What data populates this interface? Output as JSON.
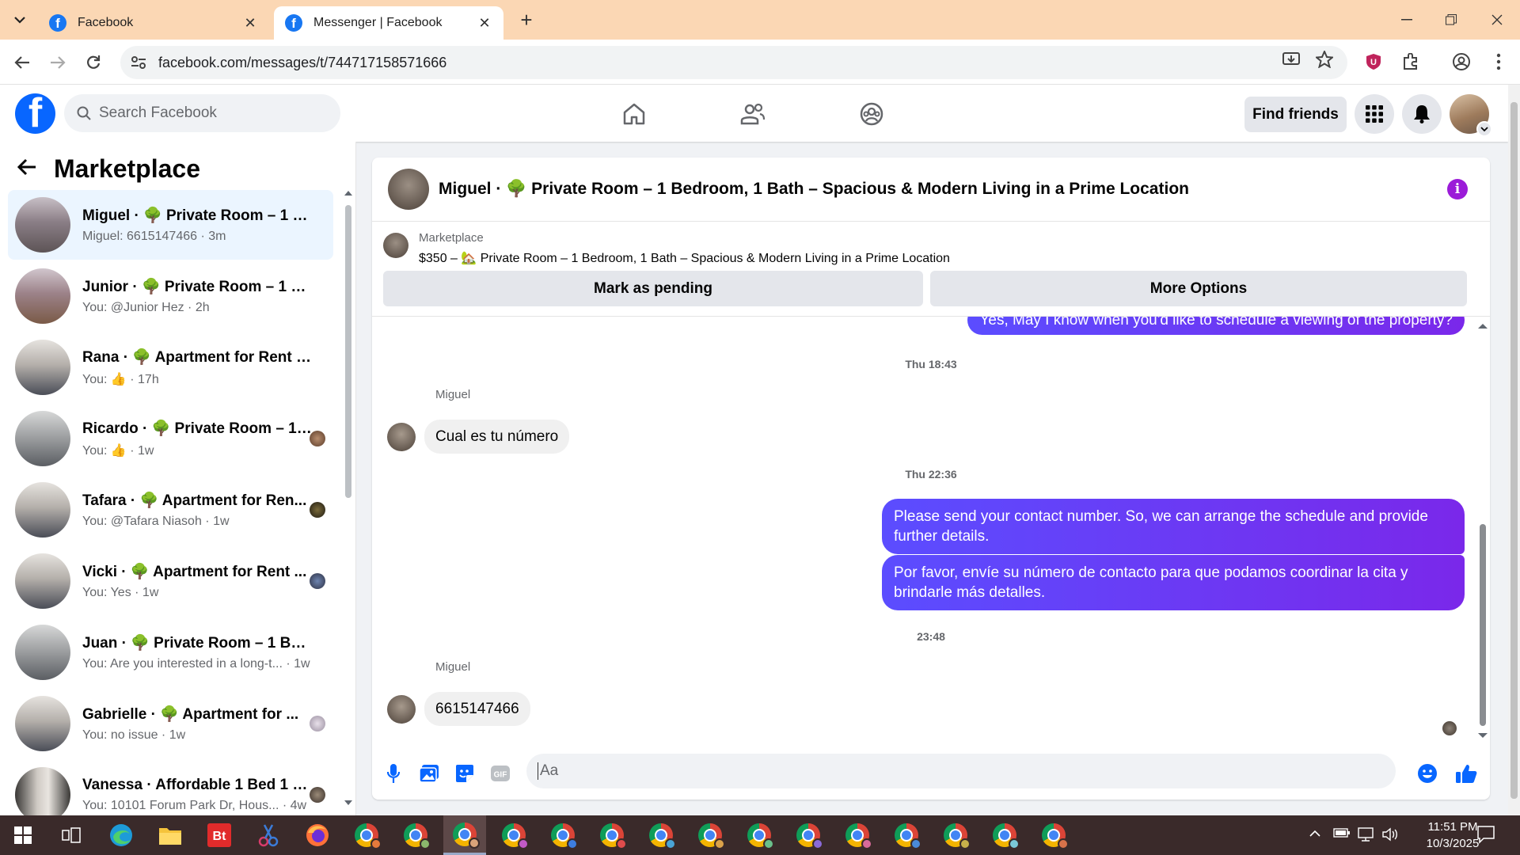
{
  "browser": {
    "tabs": [
      {
        "title": "Facebook",
        "active": false
      },
      {
        "title": "Messenger | Facebook",
        "active": true
      }
    ],
    "url": "facebook.com/messages/t/744717158571666"
  },
  "fb_header": {
    "search_placeholder": "Search Facebook",
    "find_friends": "Find friends"
  },
  "sidebar": {
    "title": "Marketplace",
    "conversations": [
      {
        "name": "Miguel · 🌳 Private Room – 1 Be...",
        "preview": "Miguel: 6615147466 · 3m",
        "selected": true
      },
      {
        "name": "Junior · 🌳 Private Room – 1 Bed...",
        "preview": "You: @Junior Hez · 2h"
      },
      {
        "name": "Rana · 🌳 Apartment for Rent – ...",
        "preview": "You: 👍 · 17h"
      },
      {
        "name": "Ricardo · 🌳 Private Room – 1 ...",
        "preview": "You: 👍 · 1w"
      },
      {
        "name": "Tafara · 🌳 Apartment for Ren...",
        "preview": "You: @Tafara Niasoh · 1w"
      },
      {
        "name": "Vicki · 🌳 Apartment for Rent ...",
        "preview": "You: Yes · 1w"
      },
      {
        "name": "Juan · 🌳 Private Room – 1 Bedr...",
        "preview": "You: Are you interested in a long-t... · 1w"
      },
      {
        "name": "Gabrielle · 🌳 Apartment for ...",
        "preview": "You: no issue · 1w"
      },
      {
        "name": "Vanessa · Affordable 1 Bed 1 B...",
        "preview": "You: 10101 Forum Park Dr, Hous... · 4w"
      }
    ]
  },
  "chat": {
    "title": "Miguel · 🌳 Private Room – 1 Bedroom, 1 Bath – Spacious & Modern Living in a Prime Location",
    "marketplace_label": "Marketplace",
    "listing": "$350 – 🏡 Private Room – 1 Bedroom, 1 Bath – Spacious & Modern Living in a Prime Location",
    "mark_pending": "Mark as pending",
    "more_options": "More Options",
    "partial_message": "Yes,  May I know when you'd like to schedule a viewing of the property?",
    "timestamps": [
      "Thu 18:43",
      "Thu 22:36",
      "23:48"
    ],
    "sender_name": "Miguel",
    "msg_in_1": "Cual es tu número",
    "msg_out_1": "Please send your contact number. So, we can arrange the schedule and provide further details.",
    "msg_out_2": "Por favor, envíe su número de contacto para que podamos coordinar la cita y brindarle más detalles.",
    "msg_in_2": "6615147466",
    "composer_placeholder": "Aa"
  },
  "taskbar": {
    "time": "11:51 PM",
    "date": "10/3/2025"
  },
  "colors": {
    "fb_blue": "#0866ff",
    "outgoing_bubble": "#5b4dff",
    "accent_purple": "#9b1bd8",
    "tabbar": "#fbd7b4",
    "taskbar": "#3a2a2a"
  }
}
